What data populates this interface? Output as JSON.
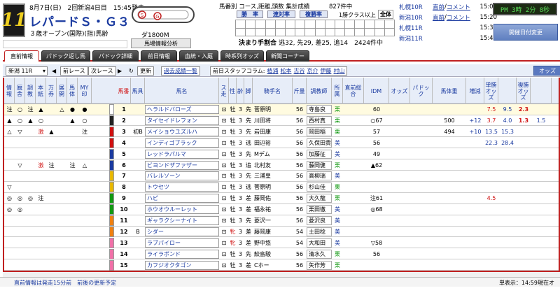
{
  "header": {
    "race_no": "11",
    "date_line": "8月7日(日)　2回新潟4日目　15:45発走",
    "race_name": "レパードＳ・Ｇ３",
    "race_cond": "３歳オープン(国際)(指)馬齢",
    "course_label": "ダ1800M",
    "horse_info_btn": "馬場情報分析",
    "mid_label": "馬番別 コース,距離,頭数 集計成績",
    "count_label": "827件中",
    "pop_label": "1勝クラス以上",
    "all_btn": "全体",
    "tab_a": "勝　率",
    "tab_b": "連対率",
    "tab_c": "複勝率",
    "summary_bold": "決まり手割合",
    "summary_rest": "逃32, 先29, 差25, 追14　2424件中"
  },
  "right_panel": {
    "rows": [
      {
        "name": "札幌10R",
        "link": "直前",
        "sep": "/",
        "comment": "コメント",
        "time": "15:01"
      },
      {
        "name": "新潟10R",
        "link": "直前",
        "sep": "/",
        "comment": "コメント",
        "time": "15:20"
      },
      {
        "name": "札幌11R",
        "link": "",
        "sep": "",
        "comment": "",
        "time": "15:30"
      },
      {
        "name": "新潟11R",
        "link": "",
        "sep": "",
        "comment": "",
        "time": "15:45"
      }
    ],
    "clock": "PM 3時 2分 8秒",
    "date_btn": "開催日付変更"
  },
  "tabs": [
    "直前情報",
    "パドック返し馬",
    "パドック詳細",
    "前日情報",
    "血統・入厩",
    "時系列オッズ",
    "新聞コーナー"
  ],
  "toolbar": {
    "race_select": "新潟 11R",
    "prev": "前レース",
    "next": "次レース",
    "update": "更新",
    "past": "過去成績一覧",
    "staff_label": "前日スタッフコラム:",
    "staff": [
      "植浦",
      "松本",
      "古谷",
      "京介",
      "伊藤",
      "村山"
    ],
    "odds": "オッズ"
  },
  "columns": [
    "情報",
    "厩舎",
    "調教",
    "本紙",
    "万券",
    "展開",
    "馬体",
    "MY印",
    "馬番",
    "馬具",
    "馬名",
    "ス走",
    "性",
    "齢",
    "脚",
    "騎手名",
    "斤量",
    "調教師",
    "所属",
    "直前総合",
    "IDM",
    "オッズ",
    "パドック",
    "馬体重",
    "増減",
    "単勝オッズ",
    "複勝オッズ"
  ],
  "horses": [
    {
      "n": "1",
      "marks": [
        "注",
        "○",
        "注",
        "▲",
        "",
        "△",
        "●",
        "●"
      ],
      "gear": "",
      "name": "ヘラルドバローズ",
      "sex": "牡",
      "age": "3",
      "style": "先",
      "jockey": "菅原明",
      "weight": "56",
      "trainer": "寺島良",
      "aff": "栗",
      "total": "",
      "idm": "60",
      "odds": "",
      "pad": "",
      "bw": "",
      "diff": "",
      "win": "7.5",
      "wodds": "9.5",
      "place": "2.3",
      "podds": "",
      "color": "#fff"
    },
    {
      "n": "2",
      "marks": [
        "▲",
        "○",
        "▲",
        "○",
        "",
        "",
        "▲",
        "○"
      ],
      "gear": "",
      "name": "タイセイドレフォン",
      "sex": "牡",
      "age": "3",
      "style": "先",
      "jockey": "川田将",
      "weight": "56",
      "trainer": "西村真",
      "aff": "栗",
      "total": "",
      "idm": "○67",
      "odds": "",
      "pad": "",
      "bw": "500",
      "diff": "+12",
      "win": "3.7",
      "wodds": "4.0",
      "place": "1.3",
      "podds": "1.5",
      "color": "#222"
    },
    {
      "n": "3",
      "marks": [
        "△",
        "▽",
        "",
        "激",
        "▲",
        "",
        "",
        "注"
      ],
      "gear": "初B",
      "name": "メイショウユズルハ",
      "sex": "牡",
      "age": "3",
      "style": "先",
      "jockey": "岩田康",
      "weight": "56",
      "trainer": "岡田稲",
      "aff": "栗",
      "total": "",
      "idm": "57",
      "odds": "",
      "pad": "",
      "bw": "494",
      "diff": "+10",
      "win": "13.5",
      "wodds": "15.3",
      "place": "",
      "podds": "",
      "color": "#d01010"
    },
    {
      "n": "4",
      "marks": [
        "",
        "",
        "",
        "",
        "",
        "",
        "",
        ""
      ],
      "gear": "",
      "name": "インディゴブラック",
      "sex": "牡",
      "age": "3",
      "style": "逃",
      "jockey": "田辺裕",
      "weight": "56",
      "trainer": "久保田貴",
      "aff": "美",
      "total": "",
      "idm": "56",
      "odds": "",
      "pad": "",
      "bw": "",
      "diff": "",
      "win": "22.3",
      "wodds": "28.4",
      "place": "",
      "podds": "",
      "color": "#d01010"
    },
    {
      "n": "5",
      "marks": [
        "",
        "",
        "",
        "",
        "",
        "",
        "",
        ""
      ],
      "gear": "",
      "name": "レッドラパルマ",
      "sex": "牡",
      "age": "3",
      "style": "先",
      "jockey": "Mデム",
      "weight": "56",
      "trainer": "加藤征",
      "aff": "美",
      "total": "",
      "idm": "49",
      "odds": "",
      "pad": "",
      "bw": "",
      "diff": "",
      "win": "",
      "wodds": "",
      "place": "",
      "podds": "",
      "color": "#1a3aa0"
    },
    {
      "n": "6",
      "marks": [
        "",
        "▽",
        "",
        "激",
        "注",
        "",
        "注",
        "△"
      ],
      "gear": "",
      "name": "ビヨンドザファザー",
      "sex": "牡",
      "age": "3",
      "style": "追",
      "jockey": "北村友",
      "weight": "56",
      "trainer": "藤岡健",
      "aff": "栗",
      "total": "",
      "idm": "▲62",
      "odds": "",
      "pad": "",
      "bw": "",
      "diff": "",
      "win": "",
      "wodds": "",
      "place": "",
      "podds": "",
      "color": "#1a3aa0"
    },
    {
      "n": "7",
      "marks": [
        "",
        "",
        "",
        "",
        "",
        "",
        "",
        ""
      ],
      "gear": "",
      "name": "バレルソーン",
      "sex": "牡",
      "age": "3",
      "style": "先",
      "jockey": "三浦皇",
      "weight": "56",
      "trainer": "高柳瑞",
      "aff": "美",
      "total": "",
      "idm": "",
      "odds": "",
      "pad": "",
      "bw": "",
      "diff": "",
      "win": "",
      "wodds": "",
      "place": "",
      "podds": "",
      "color": "#e8b800"
    },
    {
      "n": "8",
      "marks": [
        "▽",
        "",
        "",
        "",
        "",
        "",
        "",
        ""
      ],
      "gear": "",
      "name": "トウセツ",
      "sex": "牡",
      "age": "3",
      "style": "逃",
      "jockey": "菅原明",
      "weight": "56",
      "trainer": "杉山佳",
      "aff": "栗",
      "total": "",
      "idm": "",
      "odds": "",
      "pad": "",
      "bw": "",
      "diff": "",
      "win": "",
      "wodds": "",
      "place": "",
      "podds": "",
      "color": "#e8b800"
    },
    {
      "n": "9",
      "marks": [
        "◎",
        "◎",
        "◎",
        "注",
        "",
        "",
        "",
        ""
      ],
      "gear": "",
      "name": "ハピ",
      "sex": "牡",
      "age": "3",
      "style": "差",
      "jockey": "藤岡佑",
      "weight": "56",
      "trainer": "大久龍",
      "aff": "栗",
      "total": "",
      "idm": "注61",
      "odds": "",
      "pad": "",
      "bw": "",
      "diff": "",
      "win": "4.5",
      "wodds": "",
      "place": "",
      "podds": "",
      "color": "#119911"
    },
    {
      "n": "10",
      "marks": [
        "◎",
        "◎",
        "",
        "",
        "",
        "",
        "",
        ""
      ],
      "gear": "",
      "name": "ホウオウルーレット",
      "sex": "牡",
      "age": "3",
      "style": "差",
      "jockey": "福永祐",
      "weight": "56",
      "trainer": "栗田徹",
      "aff": "美",
      "total": "",
      "idm": "◎68",
      "odds": "",
      "pad": "",
      "bw": "",
      "diff": "",
      "win": "",
      "wodds": "",
      "place": "",
      "podds": "",
      "color": "#119911"
    },
    {
      "n": "11",
      "marks": [
        "",
        "",
        "",
        "",
        "",
        "",
        "",
        ""
      ],
      "gear": "",
      "name": "ギャラクシーナイト",
      "sex": "牡",
      "age": "3",
      "style": "先",
      "jockey": "菱沢一",
      "weight": "56",
      "trainer": "菱沢良",
      "aff": "美",
      "total": "",
      "idm": "",
      "odds": "",
      "pad": "",
      "bw": "",
      "diff": "",
      "win": "",
      "wodds": "",
      "place": "",
      "podds": "",
      "color": "#f08010"
    },
    {
      "n": "12",
      "marks": [
        "",
        "",
        "",
        "",
        "",
        "",
        "",
        ""
      ],
      "gear": "B",
      "name": "シダー",
      "sex": "牝",
      "age": "3",
      "style": "差",
      "jockey": "藤岡康",
      "weight": "54",
      "trainer": "土田稔",
      "aff": "美",
      "total": "",
      "idm": "",
      "odds": "",
      "pad": "",
      "bw": "",
      "diff": "",
      "win": "",
      "wodds": "",
      "place": "",
      "podds": "",
      "color": "#f08010"
    },
    {
      "n": "13",
      "marks": [
        "",
        "",
        "",
        "",
        "",
        "",
        "",
        ""
      ],
      "gear": "",
      "name": "ラブパイロー",
      "sex": "牝",
      "age": "3",
      "style": "差",
      "jockey": "野中悠",
      "weight": "54",
      "trainer": "大和田",
      "aff": "美",
      "total": "",
      "idm": "▽58",
      "odds": "",
      "pad": "",
      "bw": "",
      "diff": "",
      "win": "",
      "wodds": "",
      "place": "",
      "podds": "",
      "color": "#f070a8"
    },
    {
      "n": "14",
      "marks": [
        "",
        "",
        "",
        "",
        "",
        "",
        "",
        ""
      ],
      "gear": "",
      "name": "ライラボンド",
      "sex": "牡",
      "age": "3",
      "style": "先",
      "jockey": "鮫島駿",
      "weight": "56",
      "trainer": "清水久",
      "aff": "栗",
      "total": "",
      "idm": "56",
      "odds": "",
      "pad": "",
      "bw": "",
      "diff": "",
      "win": "",
      "wodds": "",
      "place": "",
      "podds": "",
      "color": "#f070a8"
    },
    {
      "n": "15",
      "marks": [
        "",
        "",
        "",
        "",
        "",
        "",
        "",
        ""
      ],
      "gear": "",
      "name": "カフジオクタゴン",
      "sex": "牡",
      "age": "3",
      "style": "差",
      "jockey": "Cホー",
      "weight": "56",
      "trainer": "矢作芳",
      "aff": "栗",
      "total": "",
      "idm": "",
      "odds": "",
      "pad": "",
      "bw": "",
      "diff": "",
      "win": "",
      "wodds": "",
      "place": "",
      "podds": "",
      "color": "#f070a8"
    }
  ],
  "status": {
    "left": "直前情報は発走15分前　前後の更新予定",
    "right": "単表示：14:59現在オ"
  }
}
